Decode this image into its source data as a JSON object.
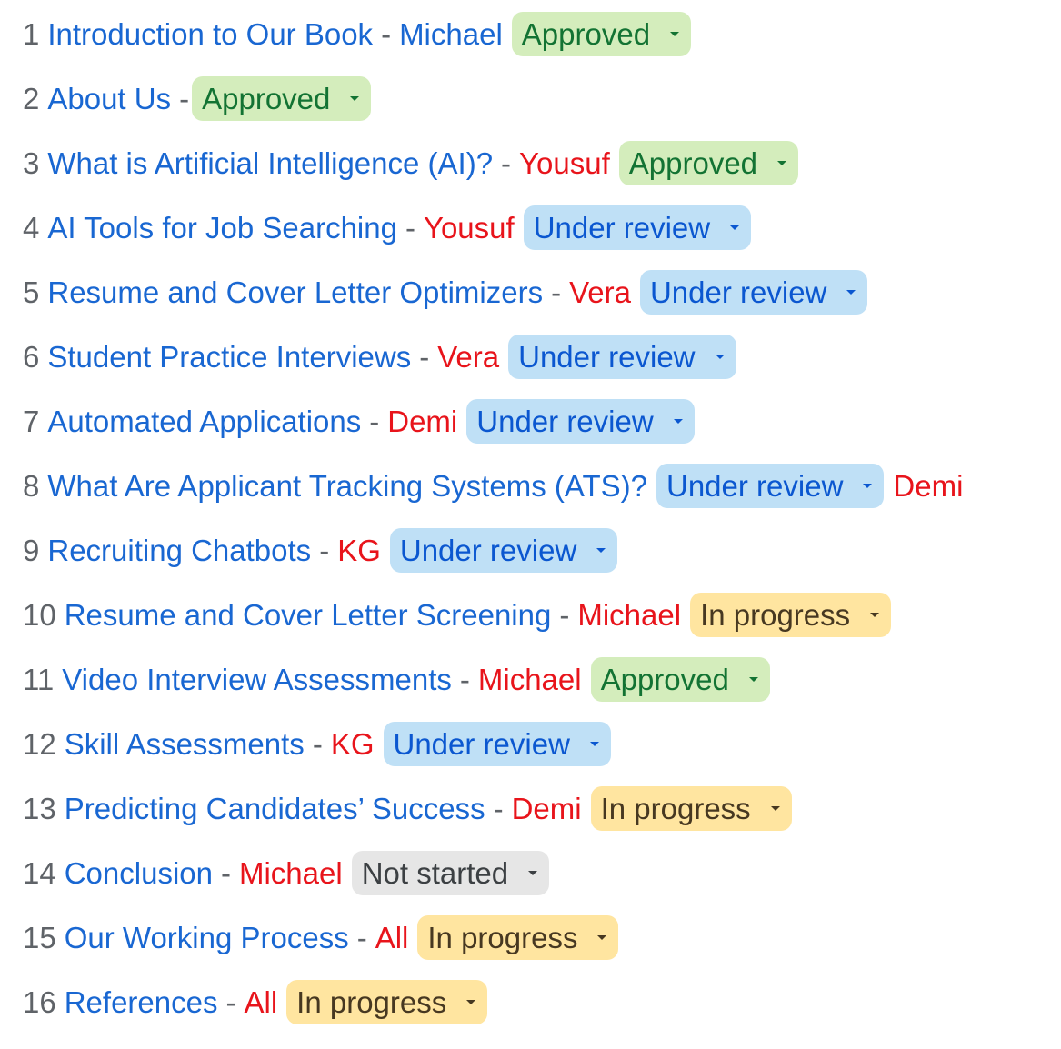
{
  "rows": [
    {
      "num": "1",
      "title": "Introduction to Our Book",
      "sep": "-",
      "author": "Michael",
      "author_color": "blue",
      "status": "Approved",
      "status_kind": "approved",
      "order": "tsac"
    },
    {
      "num": "2",
      "title": "About Us",
      "sep": "-",
      "author": "",
      "status": "Approved",
      "status_kind": "approved",
      "order": "tsc"
    },
    {
      "num": "3",
      "title": "What is Artificial Intelligence (AI)?",
      "sep": "-",
      "author": "Yousuf",
      "status": "Approved",
      "status_kind": "approved",
      "order": "tsac"
    },
    {
      "num": "4",
      "title": "AI Tools for Job Searching",
      "sep": "-",
      "author": "Yousuf",
      "status": "Under review",
      "status_kind": "review",
      "order": "tsac"
    },
    {
      "num": "5",
      "title": "Resume and Cover Letter Optimizers",
      "sep": "-",
      "author": "Vera",
      "status": "Under review",
      "status_kind": "review",
      "order": "tsac"
    },
    {
      "num": "6",
      "title": "Student Practice Interviews",
      "sep": "-",
      "author": "Vera",
      "status": "Under review",
      "status_kind": "review",
      "order": "tsac"
    },
    {
      "num": "7",
      "title": "Automated Applications",
      "sep": "-",
      "author": "Demi",
      "status": "Under review",
      "status_kind": "review",
      "order": "tsac"
    },
    {
      "num": "8",
      "title": "What Are Applicant Tracking Systems (ATS)?",
      "sep": "",
      "author": "Demi",
      "status": "Under review",
      "status_kind": "review",
      "order": "tca"
    },
    {
      "num": "9",
      "title": "Recruiting Chatbots",
      "sep": "-",
      "author": "KG",
      "status": "Under review",
      "status_kind": "review",
      "order": "tsac"
    },
    {
      "num": "10",
      "title": "Resume and Cover Letter Screening",
      "sep": "-",
      "author": "Michael",
      "status": "In progress",
      "status_kind": "progress",
      "order": "tsac"
    },
    {
      "num": "11",
      "title": "Video Interview Assessments",
      "sep": "-",
      "author": "Michael",
      "status": "Approved",
      "status_kind": "approved",
      "order": "tsac"
    },
    {
      "num": "12",
      "title": "Skill Assessments",
      "sep": "-",
      "author": "KG",
      "status": "Under review",
      "status_kind": "review",
      "order": "tsac"
    },
    {
      "num": "13",
      "title": "Predicting Candidates’ Success",
      "sep": "-",
      "author": "Demi",
      "status": "In progress",
      "status_kind": "progress",
      "order": "tsac"
    },
    {
      "num": "14",
      "title": "Conclusion",
      "sep": "-",
      "author": "Michael",
      "status": "Not started",
      "status_kind": "notstarted",
      "order": "tsac"
    },
    {
      "num": "15",
      "title": "Our Working Process",
      "sep": "-",
      "author": "All",
      "status": "In progress",
      "status_kind": "progress",
      "order": "tsac"
    },
    {
      "num": "16",
      "title": "References",
      "sep": "-",
      "author": "All",
      "status": "In progress",
      "status_kind": "progress",
      "order": "tsac"
    }
  ],
  "colors": {
    "link_blue": "#1967d2",
    "author_red": "#e8141b",
    "approved_bg": "#d4edbc",
    "approved_fg": "#137333",
    "review_bg": "#bfe0f6",
    "review_fg": "#0b57d0",
    "progress_bg": "#ffe5a0",
    "progress_fg": "#473821",
    "notstarted_bg": "#e6e6e6",
    "notstarted_fg": "#3c4043"
  },
  "icons": {
    "chip_caret": "caret-down-icon"
  }
}
